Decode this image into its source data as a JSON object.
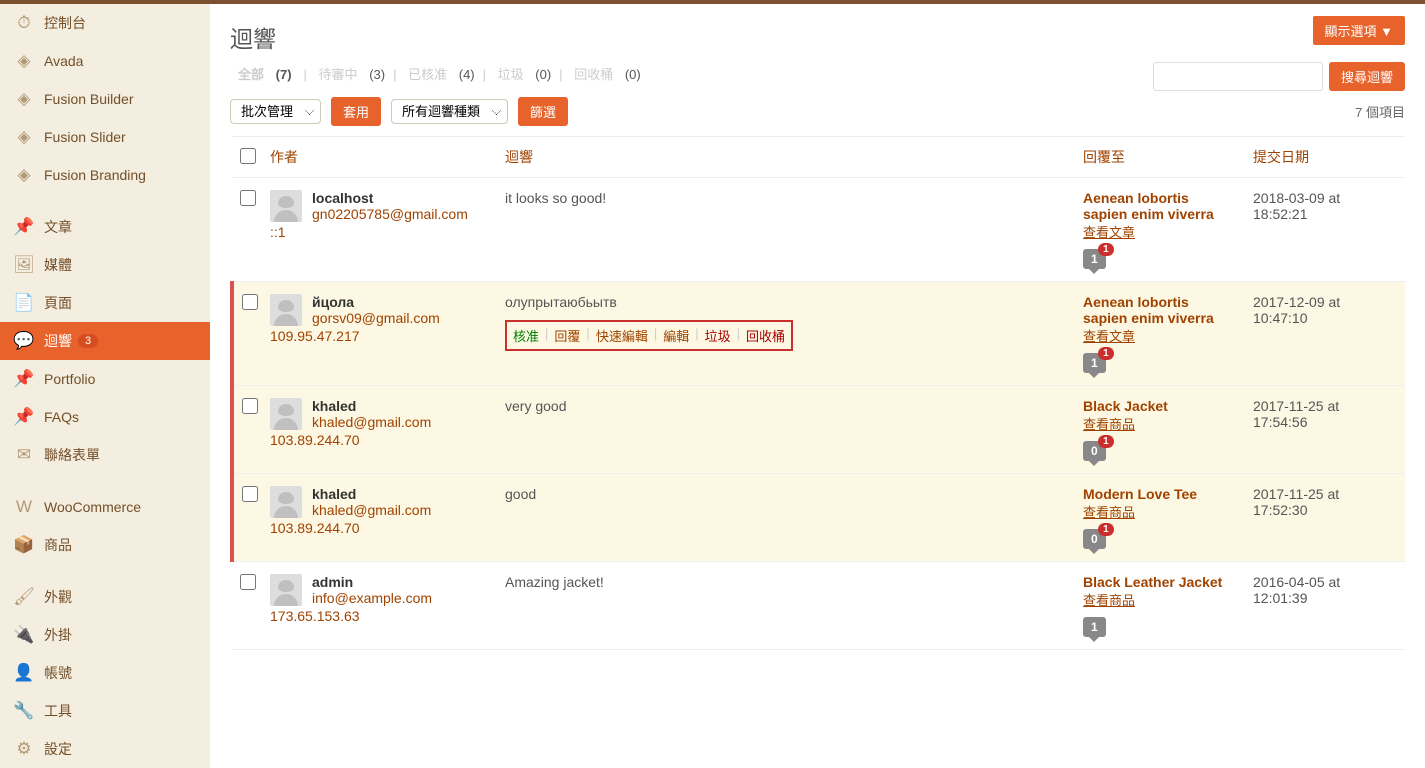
{
  "header": {
    "screen_options": "顯示選項 ▼",
    "page_title": "迴響",
    "search_button": "搜尋迴響",
    "items_count": "7 個項目"
  },
  "sidebar": {
    "items": [
      {
        "label": "控制台",
        "icon": "⏱"
      },
      {
        "label": "Avada",
        "icon": "◈"
      },
      {
        "label": "Fusion Builder",
        "icon": "◈"
      },
      {
        "label": "Fusion Slider",
        "icon": "◈"
      },
      {
        "label": "Fusion Branding",
        "icon": "◈"
      },
      {
        "sep": true
      },
      {
        "label": "文章",
        "icon": "📌"
      },
      {
        "label": "媒體",
        "icon": "🖼"
      },
      {
        "label": "頁面",
        "icon": "📄"
      },
      {
        "label": "迴響",
        "icon": "💬",
        "current": true,
        "badge": "3"
      },
      {
        "label": "Portfolio",
        "icon": "📌"
      },
      {
        "label": "FAQs",
        "icon": "📌"
      },
      {
        "label": "聯絡表單",
        "icon": "✉"
      },
      {
        "sep": true
      },
      {
        "label": "WooCommerce",
        "icon": "W"
      },
      {
        "label": "商品",
        "icon": "📦"
      },
      {
        "sep": true
      },
      {
        "label": "外觀",
        "icon": "🖌"
      },
      {
        "label": "外掛",
        "icon": "🔌"
      },
      {
        "label": "帳號",
        "icon": "👤"
      },
      {
        "label": "工具",
        "icon": "🔧"
      },
      {
        "label": "設定",
        "icon": "⚙"
      }
    ]
  },
  "filters": {
    "all": {
      "label": "全部",
      "count": "(7)"
    },
    "pending": {
      "label": "待審中",
      "count": "(3)"
    },
    "approved": {
      "label": "已核准",
      "count": "(4)"
    },
    "spam": {
      "label": "垃圾",
      "count": "(0)"
    },
    "trash": {
      "label": "回收桶",
      "count": "(0)"
    }
  },
  "bulk": {
    "select": "批次管理",
    "apply": "套用",
    "type": "所有迴響種類",
    "filter": "篩選"
  },
  "columns": {
    "author": "作者",
    "comment": "迴響",
    "reply_to": "回覆至",
    "date": "提交日期"
  },
  "row_actions": {
    "approve": "核准",
    "reply": "回覆",
    "quick_edit": "快速編輯",
    "edit": "編輯",
    "spam": "垃圾",
    "trash": "回收桶"
  },
  "rows": [
    {
      "author": "localhost",
      "email": "gn02205785@gmail.com",
      "ip": "::1",
      "content": "it looks so good!",
      "reply_title": "Aenean lobortis sapien enim viverra",
      "reply_view": "查看文章",
      "bubble": "1",
      "bubble_badge": "1",
      "date": "2018-03-09 at 18:52:21",
      "pending": false,
      "show_actions": false
    },
    {
      "author": "йцола",
      "email": "gorsv09@gmail.com",
      "ip": "109.95.47.217",
      "content": "олупрытаюбьытв",
      "reply_title": "Aenean lobortis sapien enim viverra",
      "reply_view": "查看文章",
      "bubble": "1",
      "bubble_badge": "1",
      "date": "2017-12-09 at 10:47:10",
      "pending": true,
      "show_actions": true
    },
    {
      "author": "khaled",
      "email": "khaled@gmail.com",
      "ip": "103.89.244.70",
      "content": "very good",
      "reply_title": "Black Jacket",
      "reply_view": "查看商品",
      "bubble": "0",
      "bubble_badge": "1",
      "date": "2017-11-25 at 17:54:56",
      "pending": true,
      "show_actions": false
    },
    {
      "author": "khaled",
      "email": "khaled@gmail.com",
      "ip": "103.89.244.70",
      "content": "good",
      "reply_title": "Modern Love Tee",
      "reply_view": "查看商品",
      "bubble": "0",
      "bubble_badge": "1",
      "date": "2017-11-25 at 17:52:30",
      "pending": true,
      "show_actions": false
    },
    {
      "author": "admin",
      "email": "info@example.com",
      "ip": "173.65.153.63",
      "content": "Amazing jacket!",
      "reply_title": "Black Leather Jacket",
      "reply_view": "查看商品",
      "bubble": "1",
      "bubble_badge": null,
      "date": "2016-04-05 at 12:01:39",
      "pending": false,
      "show_actions": false
    }
  ]
}
